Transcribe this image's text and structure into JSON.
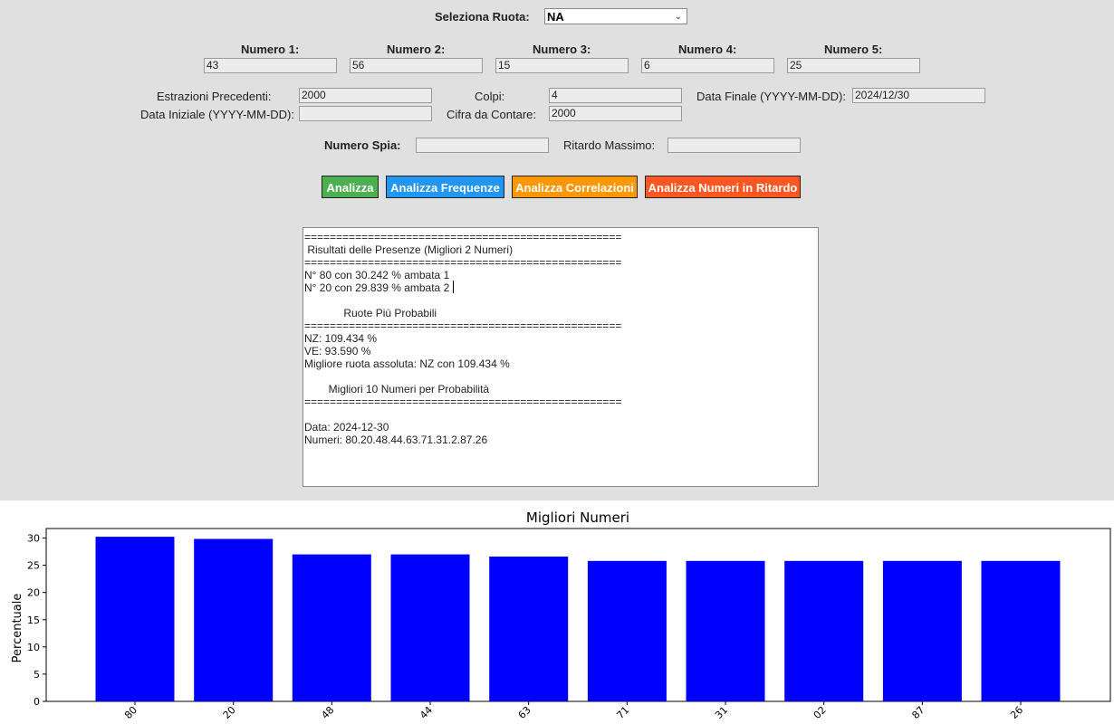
{
  "form": {
    "ruota_label": "Seleziona Ruota:",
    "ruota_value": "NA",
    "numbers": [
      {
        "label": "Numero 1:",
        "value": "43"
      },
      {
        "label": "Numero 2:",
        "value": "56"
      },
      {
        "label": "Numero 3:",
        "value": "15"
      },
      {
        "label": "Numero 4:",
        "value": "6"
      },
      {
        "label": "Numero 5:",
        "value": "25"
      }
    ],
    "estrazioni_label": "Estrazioni Precedenti:",
    "estrazioni_value": "2000",
    "colpi_label": "Colpi:",
    "colpi_value": "4",
    "data_finale_label": "Data Finale (YYYY-MM-DD):",
    "data_finale_value": "2024/12/30",
    "data_iniziale_label": "Data Iniziale (YYYY-MM-DD):",
    "data_iniziale_value": "",
    "cifra_label": "Cifra da Contare:",
    "cifra_value": "2000",
    "spia_label": "Numero Spia:",
    "spia_value": "",
    "ritardo_label": "Ritardo Massimo:",
    "ritardo_value": ""
  },
  "buttons": {
    "analizza": "Analizza",
    "frequenze": "Analizza Frequenze",
    "correlazioni": "Analizza Correlazioni",
    "ritardo": "Analizza Numeri in Ritardo"
  },
  "colors": {
    "analizza": "#4caf50",
    "frequenze": "#2196f3",
    "correlazioni": "#ff9800",
    "ritardo": "#ff5722",
    "bar": "#0000ff"
  },
  "output": {
    "lines": [
      "==================================================",
      " Risultati delle Presenze (Migliori 2 Numeri)",
      "==================================================",
      "N° 80 con 30.242 % ambata 1",
      "N° 20 con 29.839 % ambata 2",
      "",
      "             Ruote Più Probabili",
      "==================================================",
      "NZ: 109.434 %",
      "VE: 93.590 %",
      "Migliore ruota assoluta: NZ con 109.434 %",
      "",
      "        Migliori 10 Numeri per Probabilità",
      "==================================================",
      "",
      "Data: 2024-12-30",
      "Numeri: 80.20.48.44.63.71.31.2.87.26"
    ]
  },
  "chart_data": {
    "type": "bar",
    "title": "Migliori Numeri",
    "xlabel": "",
    "ylabel": "Percentuale",
    "categories": [
      "80",
      "20",
      "48",
      "44",
      "63",
      "71",
      "31",
      "02",
      "87",
      "26"
    ],
    "values": [
      30.242,
      29.839,
      27.0,
      27.0,
      26.6,
      25.8,
      25.8,
      25.8,
      25.8,
      25.8
    ],
    "yticks": [
      0,
      5,
      10,
      15,
      20,
      25,
      30
    ],
    "ylim": [
      0,
      31.75
    ],
    "color": "#0000ff",
    "grid": false
  }
}
